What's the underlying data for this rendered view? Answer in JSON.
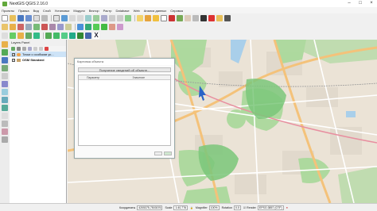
{
  "window": {
    "title": "NextGIS QGIS 2.16.0"
  },
  "menu": [
    "Проекты",
    "Правка",
    "Вид",
    "Слой",
    "Установки",
    "Модули",
    "Вектор",
    "Растр",
    "Database",
    "Web",
    "Анализ данных",
    "Справка"
  ],
  "layers_panel": {
    "title": "Layers Panel",
    "layers": [
      {
        "label": "Точки с особыми ус...",
        "checked": true,
        "selected": true
      },
      {
        "label": "OSM Standard",
        "checked": true,
        "selected": false
      }
    ]
  },
  "dialog": {
    "title": "Картинка объекта",
    "status": "Получение сведений об объекте...",
    "col_param": "Параметр",
    "col_value": "Значение"
  },
  "statusbar": {
    "coord_label": "Координаты",
    "coord_value": "4205375,7503076",
    "scale_label": "Scale",
    "scale_value": "1:40,776",
    "magnifier_label": "Magnifier",
    "magnifier_value": "100%",
    "rotation_label": "Rotation",
    "rotation_value": "0.0",
    "render_label": "Render",
    "crs_label": "EPSG:3857 (OTF)"
  },
  "colors": {
    "accent": "#5aa02c",
    "map_bg": "#ebe3d6",
    "forest": "#8fcf7f"
  }
}
